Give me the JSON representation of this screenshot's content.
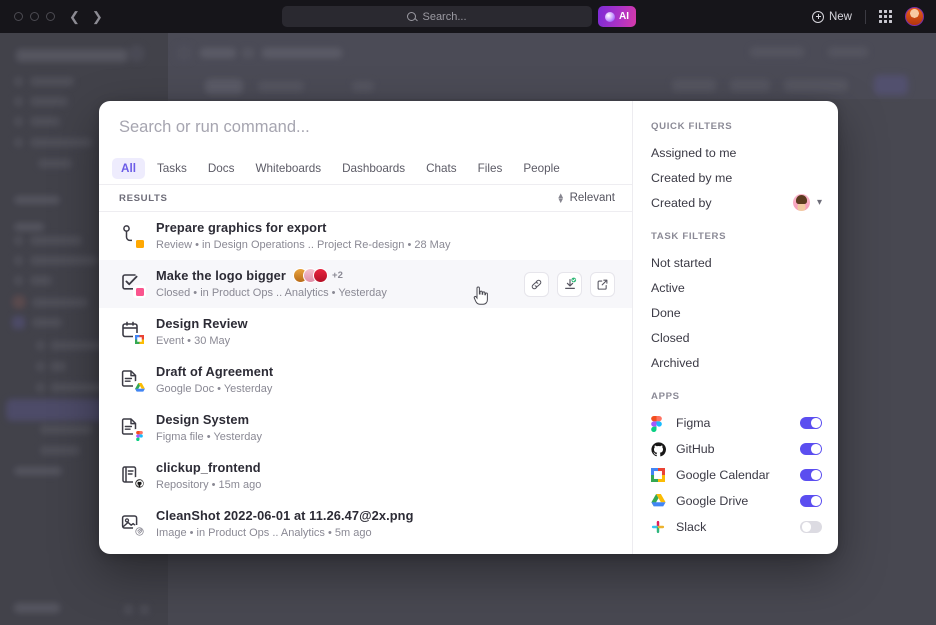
{
  "topbar": {
    "search_placeholder": "Search...",
    "ai_label": "AI",
    "new_label": "New",
    "back_icon": "chevron-left-icon",
    "forward_icon": "chevron-right-icon"
  },
  "command_palette": {
    "search_placeholder": "Search or run command...",
    "search_value": "",
    "tabs": [
      {
        "label": "All",
        "active": true
      },
      {
        "label": "Tasks",
        "active": false
      },
      {
        "label": "Docs",
        "active": false
      },
      {
        "label": "Whiteboards",
        "active": false
      },
      {
        "label": "Dashboards",
        "active": false
      },
      {
        "label": "Chats",
        "active": false
      },
      {
        "label": "Files",
        "active": false
      },
      {
        "label": "People",
        "active": false
      }
    ],
    "results_label": "RESULTS",
    "sort_label": "Relevant",
    "results": [
      {
        "title": "Prepare graphics for export",
        "icon": "subtask-icon",
        "status_color": "#FFA802",
        "meta": [
          "Review",
          "in Design Operations ..",
          "Project Re-design",
          "28 May"
        ],
        "meta_text": "Review  •  in Design Operations ..  Project Re-design  •  28 May",
        "selected": false,
        "avatars": [],
        "avatar_overflow": ""
      },
      {
        "title": "Make the logo bigger",
        "icon": "task-check-icon",
        "status_color": "#FA558E",
        "meta": [
          "Closed",
          "in Product Ops ..",
          "Analytics",
          "Yesterday"
        ],
        "meta_text": "Closed  •  in Product Ops ..  Analytics  •  Yesterday",
        "selected": true,
        "avatars": [
          "avatar-orange",
          "avatar-pink",
          "avatar-red"
        ],
        "avatar_overflow": "+2",
        "actions": [
          "link-icon",
          "pin-check-icon",
          "open-external-icon"
        ]
      },
      {
        "title": "Design Review",
        "icon": "calendar-icon",
        "badge_app": "google-calendar-icon",
        "meta_text": "Event  •  30 May",
        "selected": false
      },
      {
        "title": "Draft of Agreement",
        "icon": "document-icon",
        "badge_app": "google-drive-icon",
        "meta_text": "Google Doc  •  Yesterday",
        "selected": false
      },
      {
        "title": "Design System",
        "icon": "document-icon",
        "badge_app": "figma-icon",
        "meta_text": "Figma file  •  Yesterday",
        "selected": false
      },
      {
        "title": "clickup_frontend",
        "icon": "repository-icon",
        "badge_app": "github-icon",
        "meta_text": "Repository  •  15m ago",
        "selected": false
      },
      {
        "title": "CleanShot 2022-06-01 at 11.26.47@2x.png",
        "icon": "image-icon",
        "badge_app": "attachment-icon",
        "meta_text": "Image  •  in Product Ops ..  Analytics  •  5m ago",
        "selected": false
      }
    ]
  },
  "sidebar": {
    "quick_filters_header": "QUICK FILTERS",
    "quick_filters": [
      {
        "label": "Assigned to me",
        "has_avatar": false
      },
      {
        "label": "Created by me",
        "has_avatar": false
      },
      {
        "label": "Created by",
        "has_avatar": true
      }
    ],
    "task_filters_header": "TASK FILTERS",
    "task_filters": [
      {
        "label": "Not started"
      },
      {
        "label": "Active"
      },
      {
        "label": "Done"
      },
      {
        "label": "Closed"
      },
      {
        "label": "Archived"
      }
    ],
    "apps_header": "APPS",
    "apps": [
      {
        "label": "Figma",
        "icon": "figma-icon",
        "enabled": true
      },
      {
        "label": "GitHub",
        "icon": "github-icon",
        "enabled": true
      },
      {
        "label": "Google Calendar",
        "icon": "google-calendar-icon",
        "enabled": true
      },
      {
        "label": "Google Drive",
        "icon": "google-drive-icon",
        "enabled": true
      },
      {
        "label": "Slack",
        "icon": "slack-icon",
        "enabled": false
      }
    ]
  },
  "colors": {
    "accent": "#6B5CE7",
    "toggle_on": "#5B4EF0",
    "toggle_off": "#DCDBE2",
    "tab_active_bg": "#EEECFD",
    "row_selected_bg": "#F7F7FA"
  }
}
